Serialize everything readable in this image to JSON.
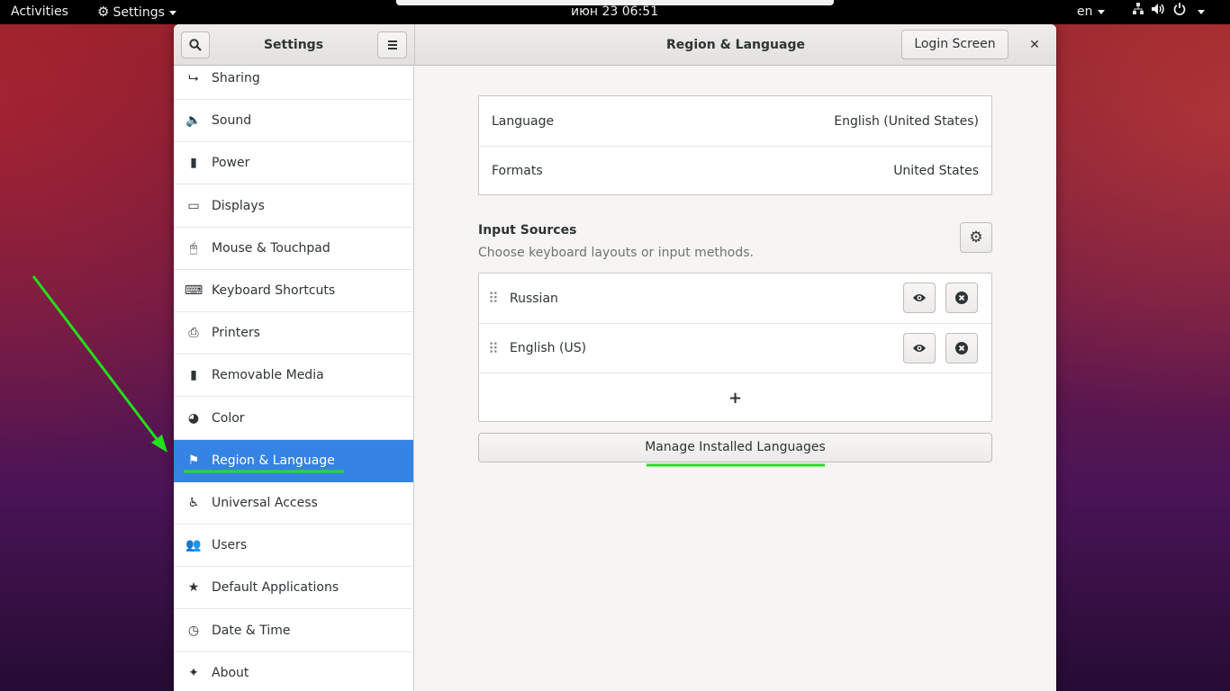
{
  "topbar": {
    "activities": "Activities",
    "app_menu": "Settings",
    "clock": "июн 23  06:51",
    "lang": "en",
    "tray_icons": [
      "network-icon",
      "volume-icon",
      "power-icon"
    ]
  },
  "window": {
    "sidebar_title": "Settings",
    "main_title": "Region & Language",
    "login_screen_label": "Login Screen",
    "close_label": "✕"
  },
  "sidebar": {
    "items": [
      {
        "label": "Sharing",
        "icon": "share-icon"
      },
      {
        "label": "Sound",
        "icon": "speaker-icon"
      },
      {
        "label": "Power",
        "icon": "battery-icon"
      },
      {
        "label": "Displays",
        "icon": "display-icon"
      },
      {
        "label": "Mouse & Touchpad",
        "icon": "mouse-icon"
      },
      {
        "label": "Keyboard Shortcuts",
        "icon": "keyboard-icon"
      },
      {
        "label": "Printers",
        "icon": "printer-icon"
      },
      {
        "label": "Removable Media",
        "icon": "usb-icon"
      },
      {
        "label": "Color",
        "icon": "color-icon"
      },
      {
        "label": "Region & Language",
        "icon": "flag-icon",
        "active": true
      },
      {
        "label": "Universal Access",
        "icon": "accessibility-icon"
      },
      {
        "label": "Users",
        "icon": "users-icon"
      },
      {
        "label": "Default Applications",
        "icon": "star-icon"
      },
      {
        "label": "Date & Time",
        "icon": "clock-icon"
      },
      {
        "label": "About",
        "icon": "sparkle-icon"
      }
    ]
  },
  "region": {
    "language_label": "Language",
    "language_value": "English (United States)",
    "formats_label": "Formats",
    "formats_value": "United States",
    "input_sources_title": "Input Sources",
    "input_sources_subtitle": "Choose keyboard layouts or input methods.",
    "sources": [
      {
        "label": "Russian"
      },
      {
        "label": "English (US)"
      }
    ],
    "add_label": "+",
    "manage_label": "Manage Installed Languages"
  },
  "colors": {
    "accent": "#3584e4",
    "annotation": "#22e01a"
  }
}
